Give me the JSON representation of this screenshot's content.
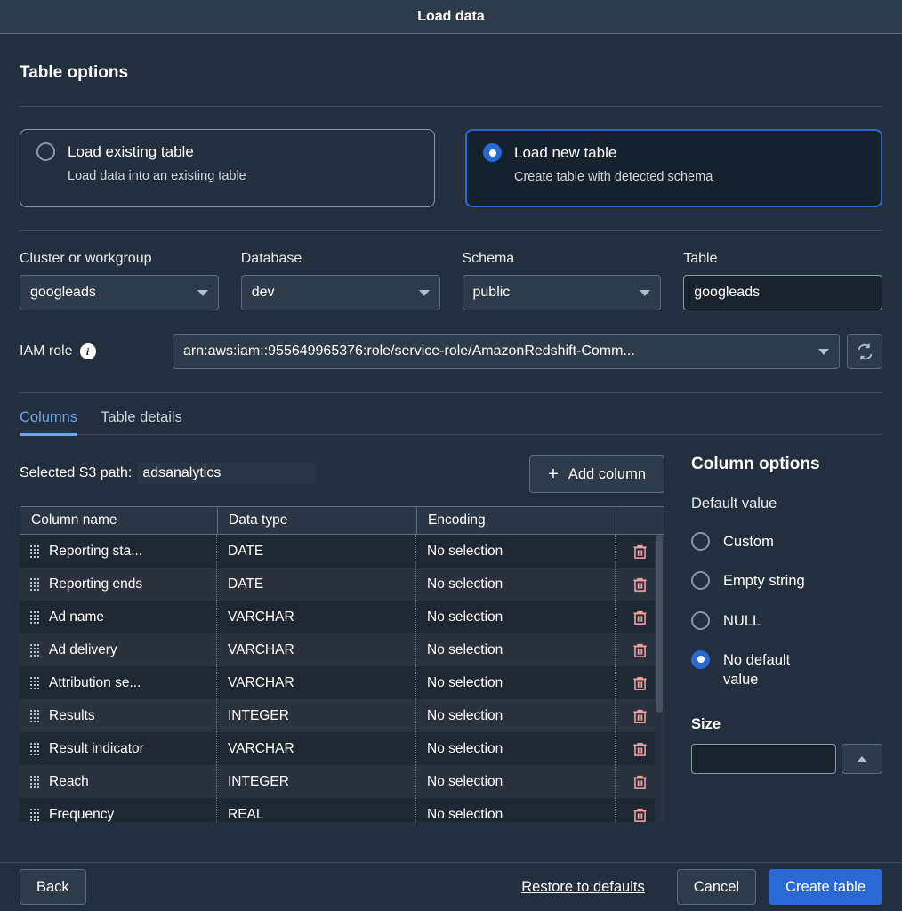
{
  "window": {
    "title": "Load data"
  },
  "table_options": {
    "heading": "Table options",
    "cards": [
      {
        "title": "Load existing table",
        "description": "Load data into an existing table",
        "selected": false
      },
      {
        "title": "Load new table",
        "description": "Create table with detected schema",
        "selected": true
      }
    ]
  },
  "selectors": {
    "cluster": {
      "label": "Cluster or workgroup",
      "value": "googleads"
    },
    "database": {
      "label": "Database",
      "value": "dev"
    },
    "schema": {
      "label": "Schema",
      "value": "public"
    },
    "table": {
      "label": "Table",
      "value": "googleads"
    }
  },
  "iam": {
    "label": "IAM role",
    "info_icon": "info-icon",
    "value": "arn:aws:iam::955649965376:role/service-role/AmazonRedshift-Comm...",
    "refresh_icon": "refresh-icon"
  },
  "tabs": [
    {
      "label": "Columns",
      "active": true
    },
    {
      "label": "Table details",
      "active": false
    }
  ],
  "toolbar": {
    "s3_path_label": "Selected S3 path:",
    "s3_path_value": "adsanalytics",
    "add_column_label": "Add column",
    "plus_icon": "plus-icon"
  },
  "columns_table": {
    "headers": [
      "Column name",
      "Data type",
      "Encoding",
      ""
    ],
    "rows": [
      {
        "name": "Reporting sta...",
        "type": "DATE",
        "encoding": "No selection"
      },
      {
        "name": "Reporting ends",
        "type": "DATE",
        "encoding": "No selection"
      },
      {
        "name": "Ad name",
        "type": "VARCHAR",
        "encoding": "No selection"
      },
      {
        "name": "Ad delivery",
        "type": "VARCHAR",
        "encoding": "No selection"
      },
      {
        "name": "Attribution se...",
        "type": "VARCHAR",
        "encoding": "No selection"
      },
      {
        "name": "Results",
        "type": "INTEGER",
        "encoding": "No selection"
      },
      {
        "name": "Result indicator",
        "type": "VARCHAR",
        "encoding": "No selection"
      },
      {
        "name": "Reach",
        "type": "INTEGER",
        "encoding": "No selection"
      },
      {
        "name": "Frequency",
        "type": "REAL",
        "encoding": "No selection"
      }
    ]
  },
  "column_options": {
    "title": "Column options",
    "default_value_label": "Default value",
    "choices": [
      {
        "label": "Custom",
        "selected": false
      },
      {
        "label": "Empty string",
        "selected": false
      },
      {
        "label": "NULL",
        "selected": false
      },
      {
        "label": "No default value",
        "selected": true
      }
    ],
    "size_label": "Size",
    "size_value": ""
  },
  "footer": {
    "back_label": "Back",
    "restore_label": "Restore to defaults",
    "cancel_label": "Cancel",
    "create_label": "Create table"
  },
  "colors": {
    "accent_blue": "#2a69d4",
    "tab_blue": "#6fa6e8",
    "trash_red": "#f3a0a0",
    "body_bg": "#232f3e",
    "header_bg": "#2e3b4a"
  }
}
